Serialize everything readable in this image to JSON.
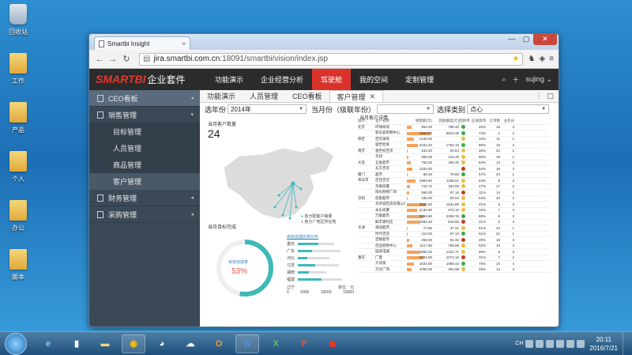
{
  "desktop": {
    "icons": [
      "回收站",
      "工作",
      "产品",
      "个人",
      "办公",
      "脚本"
    ]
  },
  "browser": {
    "tab_title": "Smartbi Insight",
    "url_prefix": "jira.smartbi.com.cn",
    "url_suffix": ":18091/smartbi/vision/index.jsp"
  },
  "app": {
    "logo": "SMARTBI",
    "logo_sub": "企业套件",
    "nav": [
      "功能演示",
      "企业经营分析",
      "驾驶舱",
      "我的空间",
      "定制管理"
    ],
    "active_nav": "驾驶舱",
    "user": "sujing",
    "sidebar": {
      "items": [
        {
          "label": "CEO看板",
          "arrow": "◂"
        },
        {
          "label": "销售管理",
          "arrow": "▾"
        },
        {
          "label": "财务管理",
          "arrow": "◂"
        },
        {
          "label": "采购管理",
          "arrow": "◂"
        }
      ],
      "subitems": [
        "目标管理",
        "人员管理",
        "商品管理",
        "客户管理"
      ],
      "active_sub": "客户管理"
    },
    "tabs": [
      "功能演示",
      "人员管理",
      "CEO看板",
      "客户管理"
    ],
    "active_tab": "客户管理",
    "filters": {
      "year_label": "选年份",
      "year_value": "2014年",
      "month_label": "当月份（级联年份）",
      "month_value": "",
      "category_label": "选择类别",
      "category_value": "点心"
    },
    "panels": {
      "customers_title": "当月客户数量",
      "customers_count": "24",
      "map_legend_1": "各分配客户销量",
      "map_legend_2": "各分厂地区所在地",
      "target_title": "当月目标完成",
      "target_caption": "目标完成率",
      "target_percent": "53%",
      "dist_title": "目标完成比例分布",
      "dist_axis_left": "辽宁",
      "dist_axis_right": "单位：元",
      "dist_ticks": [
        "0",
        "5000",
        "10000",
        "15000"
      ],
      "dist_rows": [
        "重庆",
        "广东",
        "河北",
        "江苏",
        "湖南",
        "福建"
      ],
      "table_title": "当月客户详情"
    },
    "table": {
      "headers": [
        "城市",
        "客户名称",
        "销售额(元)",
        "回收额度(元)",
        "回款率",
        "应收款项（元）",
        "订单数",
        "业务员"
      ],
      "rows": [
        [
          "北京",
          "环球商场",
          "963.20",
          "789.40",
          "#3ba94b",
          "45%",
          "15",
          "3"
        ],
        [
          "",
          "新东安购物中心",
          "4900.00",
          "6643.35",
          "#3ba94b",
          "74%",
          "1",
          "4"
        ],
        [
          "保定",
          "百货采购",
          "1440.00",
          "",
          "#e8c13a",
          "10%",
          "11",
          "1"
        ],
        [
          "",
          "盛世批发",
          "2222.40",
          "1762.16",
          "#3ba94b",
          "80%",
          "16",
          "3"
        ],
        [
          "南京",
          "金世纪百货",
          "163.20",
          "20.64",
          "#e8c13a",
          "26%",
          "22",
          "1"
        ],
        [
          "",
          "华润",
          "399.00",
          "315.20",
          "#e8c13a",
          "80%",
          "19",
          "1"
        ],
        [
          "大连",
          "五金超市",
          "760.00",
          "369.40",
          "#e8c13a",
          "54%",
          "14",
          "3"
        ],
        [
          "",
          "东方百货",
          "1200.00",
          "",
          "#c0392b",
          "54%",
          "16",
          "3"
        ],
        [
          "厦门",
          "超市",
          "86.40",
          "79.80",
          "#3ba94b",
          "87%",
          "23",
          "1"
        ],
        [
          "青岛市",
          "佳佳百货",
          "1863.60",
          "1188.01",
          "#e8c13a",
          "63%",
          "9",
          "3"
        ],
        [
          "",
          "华联商厦",
          "716.72",
          "334.00",
          "#e8c13a",
          "47%",
          "17",
          "2"
        ],
        [
          "",
          "阳光购物广场",
          "566.00",
          "97.16",
          "#c0392b",
          "11%",
          "14",
          "3"
        ],
        [
          "深圳",
          "佰家超市",
          "165.00",
          "90.04",
          "#e8c13a",
          "63%",
          "20",
          "2"
        ],
        [
          "",
          "华侨城百货有限公司",
          "3991.60",
          "1634.80",
          "#e8c13a",
          "41%",
          "6",
          "3"
        ],
        [
          "",
          "永乐商厦",
          "2132.60",
          "672.10",
          "#e8c13a",
          "32%",
          "7",
          "3"
        ],
        [
          "",
          "万联超市",
          "3460.80",
          "2408.76",
          "#3ba94b",
          "69%",
          "8",
          "3"
        ],
        [
          "",
          "鲜丰便利店",
          "2592.40",
          "815.86",
          "#c0392b",
          "31%",
          "6",
          "3"
        ],
        [
          "天津",
          "海润超市",
          "72.96",
          "37.21",
          "#e8c13a",
          "51%",
          "24",
          "1"
        ],
        [
          "",
          "时代百货",
          "112.00",
          "87.13",
          "#3ba94b",
          "61%",
          "21",
          "1"
        ],
        [
          "",
          "百联超市",
          "459.00",
          "91.32",
          "#c0392b",
          "20%",
          "18",
          "3"
        ],
        [
          "",
          "佳品购物中心",
          "1117.60",
          "708.88",
          "#e8c13a",
          "63%",
          "10",
          "3"
        ],
        [
          "",
          "国美电器",
          "2560.32",
          "1421.71",
          "#e8c13a",
          "56%",
          "5",
          "3"
        ],
        [
          "重庆",
          "广夏",
          "3462.00",
          "1072.16",
          "#c0392b",
          "31%",
          "7",
          "2"
        ],
        [
          "",
          "大润发",
          "1533.00",
          "1098.44",
          "#3ba94b",
          "75%",
          "10",
          "4"
        ],
        [
          "",
          "万达广场",
          "1056.00",
          "491.98",
          "#e8c13a",
          "49%",
          "12",
          "3"
        ]
      ]
    }
  },
  "taskbar": {
    "clock_time": "20:11",
    "clock_date": "2016/7/21",
    "lang": "CH"
  }
}
